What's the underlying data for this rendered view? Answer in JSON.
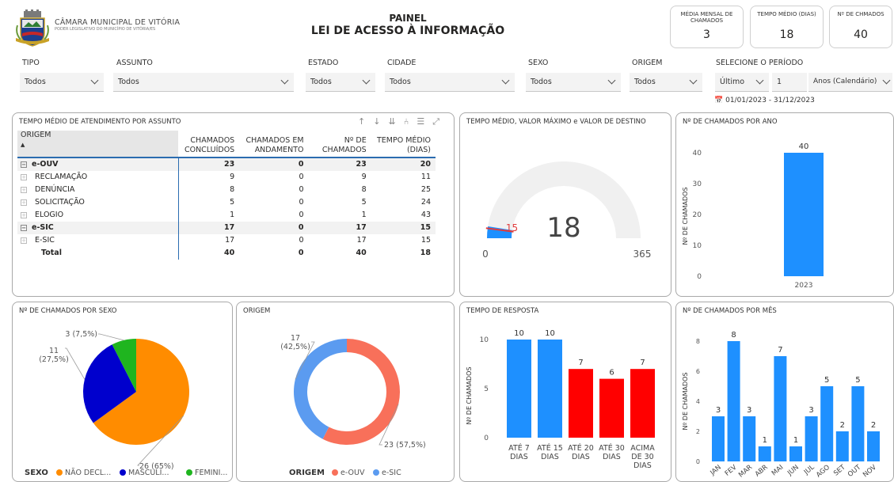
{
  "header": {
    "org_name": "CÂMARA MUNICIPAL DE VITÓRIA",
    "org_subtitle": "PODER LEGISLATIVO DO MUNICÍPIO DE VITÓRIA/ES",
    "title_line1": "PAINEL",
    "title_line2": "LEI DE ACESSO À INFORMAÇÃO"
  },
  "kpis": [
    {
      "label": "MÉDIA MENSAL DE CHAMADOS",
      "value": "3"
    },
    {
      "label": "TEMPO MÉDIO (DIAS)",
      "value": "18"
    },
    {
      "label": "Nº DE CHMADOS",
      "value": "40"
    }
  ],
  "filters": {
    "tipo": {
      "label": "TIPO",
      "value": "Todos"
    },
    "assunto": {
      "label": "ASSUNTO",
      "value": "Todos"
    },
    "estado": {
      "label": "ESTADO",
      "value": "Todos"
    },
    "cidade": {
      "label": "CIDADE",
      "value": "Todos"
    },
    "sexo": {
      "label": "SEXO",
      "value": "Todos"
    },
    "origem": {
      "label": "ORIGEM",
      "value": "Todos"
    },
    "periodo": {
      "label": "SELECIONE O PERÍODO",
      "relative": "Último",
      "count": "1",
      "unit": "Anos (Calendário)",
      "range": "01/01/2023 - 31/12/2023"
    }
  },
  "table": {
    "title": "TEMPO MÉDIO DE ATENDIMENTO POR ASSUNTO",
    "columns": [
      "ORIGEM",
      "CHAMADOS CONCLUÍDOS",
      "CHAMADOS EM ANDAMENTO",
      "Nº DE CHAMADOS",
      "TEMPO MÉDIO (DIAS)"
    ],
    "rows": [
      {
        "name": "e-OUV",
        "level": 0,
        "values": [
          "23",
          "0",
          "23",
          "20"
        ]
      },
      {
        "name": "RECLAMAÇÃO",
        "level": 1,
        "values": [
          "9",
          "0",
          "9",
          "11"
        ]
      },
      {
        "name": "DENÚNCIA",
        "level": 1,
        "values": [
          "8",
          "0",
          "8",
          "25"
        ]
      },
      {
        "name": "SOLICITAÇÃO",
        "level": 1,
        "values": [
          "5",
          "0",
          "5",
          "24"
        ]
      },
      {
        "name": "ELOGIO",
        "level": 1,
        "values": [
          "1",
          "0",
          "1",
          "43"
        ]
      },
      {
        "name": "e-SIC",
        "level": 0,
        "values": [
          "17",
          "0",
          "17",
          "15"
        ]
      },
      {
        "name": "E-SIC",
        "level": 1,
        "values": [
          "17",
          "0",
          "17",
          "15"
        ]
      }
    ],
    "total": {
      "name": "Total",
      "values": [
        "40",
        "0",
        "40",
        "18"
      ]
    }
  },
  "gauge": {
    "title": "TEMPO MÉDIO, VALOR MÁXIMO e VALOR DE DESTINO",
    "value_label": "18",
    "min_label": "0",
    "max_label": "365",
    "target_label": "15",
    "value": 18,
    "min": 0,
    "max": 365,
    "target": 15
  },
  "year_chart": {
    "title": "Nº DE CHAMADOS POR ANO",
    "ylabel": "Nº DE CHAMADOS",
    "ticks": [
      "0",
      "10",
      "20",
      "30",
      "40"
    ],
    "category": "2023",
    "value_label": "40"
  },
  "sexo_chart": {
    "title": "Nº DE CHAMADOS POR SEXO",
    "legend_title": "SEXO",
    "slices": [
      {
        "name": "NÃO DECL...",
        "label": "26 (65%)",
        "value": 26,
        "color": "#ff8c00"
      },
      {
        "name": "MASCULI...",
        "label": "11\n(27,5%)",
        "value": 11,
        "color": "#0000cd"
      },
      {
        "name": "FEMINI...",
        "label": "3 (7,5%)",
        "value": 3,
        "color": "#1fb51f"
      }
    ]
  },
  "origem_chart": {
    "title": "ORIGEM",
    "legend_title": "ORIGEM",
    "slices": [
      {
        "name": "e-OUV",
        "label": "23 (57,5%)",
        "value": 23,
        "color": "#f8705a"
      },
      {
        "name": "e-SIC",
        "label": "17\n(42,5%)",
        "value": 17,
        "color": "#5b9bf0"
      }
    ]
  },
  "resposta_chart": {
    "title": "TEMPO DE RESPOSTA",
    "ylabel": "Nº DE CHAMADOS",
    "ticks": [
      "0",
      "5",
      "10"
    ],
    "bars": [
      {
        "label": "ATÉ 7\nDIAS",
        "value": 10,
        "color": "#1e90ff"
      },
      {
        "label": "ATÉ 15\nDIAS",
        "value": 10,
        "color": "#1e90ff"
      },
      {
        "label": "ATÉ 20\nDIAS",
        "value": 7,
        "color": "#ff0000"
      },
      {
        "label": "ATÉ 30\nDIAS",
        "value": 6,
        "color": "#ff0000"
      },
      {
        "label": "ACIMA\nDE 30\nDIAS",
        "value": 7,
        "color": "#ff0000"
      }
    ]
  },
  "mes_chart": {
    "title": "Nº DE CHAMADOS POR MÊS",
    "ylabel": "Nº DE CHAMADOS",
    "ticks": [
      "0",
      "2",
      "4",
      "6",
      "8"
    ],
    "bars": [
      {
        "label": "JAN",
        "value": 3
      },
      {
        "label": "FEV",
        "value": 8
      },
      {
        "label": "MAR",
        "value": 3
      },
      {
        "label": "ABR",
        "value": 1
      },
      {
        "label": "MAI",
        "value": 7
      },
      {
        "label": "JUN",
        "value": 1
      },
      {
        "label": "JUL",
        "value": 3
      },
      {
        "label": "AGO",
        "value": 5
      },
      {
        "label": "SET",
        "value": 2
      },
      {
        "label": "OUT",
        "value": 5
      },
      {
        "label": "NOV",
        "value": 2
      }
    ]
  },
  "chart_data": [
    {
      "type": "bar",
      "categories": [
        "2023"
      ],
      "values": [
        40
      ],
      "title": "Nº DE CHAMADOS POR ANO",
      "ylabel": "Nº DE CHAMADOS",
      "ylim": [
        0,
        40
      ]
    },
    {
      "type": "pie",
      "categories": [
        "NÃO DECL...",
        "MASCULI...",
        "FEMINI..."
      ],
      "values": [
        26,
        11,
        3
      ],
      "title": "Nº DE CHAMADOS POR SEXO"
    },
    {
      "type": "pie",
      "categories": [
        "e-OUV",
        "e-SIC"
      ],
      "values": [
        23,
        17
      ],
      "title": "ORIGEM"
    },
    {
      "type": "bar",
      "categories": [
        "ATÉ 7 DIAS",
        "ATÉ 15 DIAS",
        "ATÉ 20 DIAS",
        "ATÉ 30 DIAS",
        "ACIMA DE 30 DIAS"
      ],
      "values": [
        10,
        10,
        7,
        6,
        7
      ],
      "title": "TEMPO DE RESPOSTA",
      "ylabel": "Nº DE CHAMADOS"
    },
    {
      "type": "bar",
      "categories": [
        "JAN",
        "FEV",
        "MAR",
        "ABR",
        "MAI",
        "JUN",
        "JUL",
        "AGO",
        "SET",
        "OUT",
        "NOV"
      ],
      "values": [
        3,
        8,
        3,
        1,
        7,
        1,
        3,
        5,
        2,
        5,
        2
      ],
      "title": "Nº DE CHAMADOS POR MÊS",
      "ylabel": "Nº DE CHAMADOS",
      "ylim": [
        0,
        8
      ]
    }
  ]
}
